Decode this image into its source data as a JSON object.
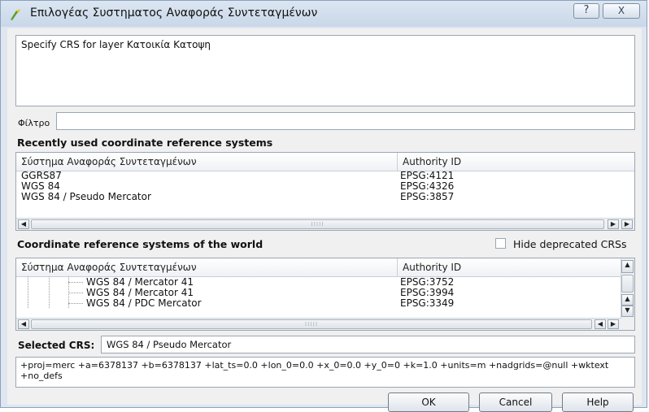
{
  "window": {
    "title": "Επιλογέας Συστηματος Αναφοράς Συντεταγμένων",
    "help_glyph": "?",
    "close_glyph": "X"
  },
  "message": "Specify CRS for layer Κατοικία Κατοψη",
  "filter": {
    "label": "Φίλτρο",
    "value": ""
  },
  "recent": {
    "title": "Recently used coordinate reference systems",
    "columns": [
      "Σύστημα Αναφοράς Συντεταγμένων",
      "Authority ID"
    ],
    "rows": [
      {
        "name": "GGRS87",
        "id": "EPSG:4121"
      },
      {
        "name": "WGS 84",
        "id": "EPSG:4326"
      },
      {
        "name": "WGS 84 / Pseudo Mercator",
        "id": "EPSG:3857"
      }
    ]
  },
  "world": {
    "title": "Coordinate reference systems of the world",
    "hide_deprecated_label": "Hide deprecated CRSs",
    "hide_deprecated_checked": false,
    "columns": [
      "Σύστημα Αναφοράς Συντεταγμένων",
      "Authority ID"
    ],
    "rows": [
      {
        "name": "WGS 84 / Mercator 41",
        "id": "EPSG:3752"
      },
      {
        "name": "WGS 84 / Mercator 41",
        "id": "EPSG:3994"
      },
      {
        "name": "WGS 84 / PDC Mercator",
        "id": "EPSG:3349"
      }
    ]
  },
  "selected": {
    "label": "Selected CRS:",
    "value": "WGS 84 / Pseudo Mercator"
  },
  "proj": "+proj=merc +a=6378137 +b=6378137 +lat_ts=0.0 +lon_0=0.0 +x_0=0.0 +y_0=0 +k=1.0 +units=m +nadgrids=@null +wktext  +no_defs",
  "buttons": {
    "ok": "OK",
    "cancel": "Cancel",
    "help": "Help"
  },
  "colors": {
    "title_bar": "#c9d7e8",
    "dialog_bg": "#f0f0f0",
    "border": "#9aa6b4"
  }
}
